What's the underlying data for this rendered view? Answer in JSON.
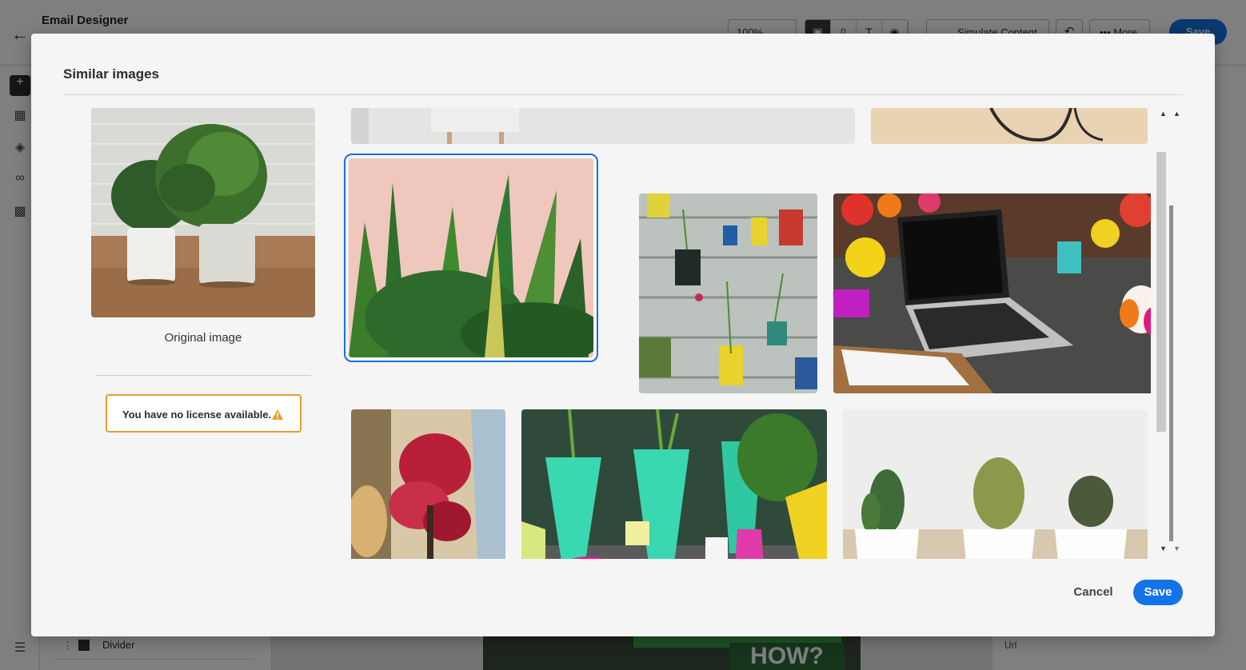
{
  "app": {
    "title": "Email Designer",
    "zoom": "100%",
    "simulate_label": "Simulate Content",
    "more_label": "More",
    "save_label": "Save",
    "panel_item_divider": "Divider",
    "right_panel_url_label": "Url",
    "canvas_text": "HOW?"
  },
  "modal": {
    "title": "Similar images",
    "original_caption": "Original image",
    "license_warning": "You have no license available.",
    "cancel_label": "Cancel",
    "save_label": "Save"
  },
  "gallery": {
    "selected_index": 0,
    "images": [
      {
        "name": "snake-plant-pink-wall"
      },
      {
        "name": "hanging-tin-can-planters"
      },
      {
        "name": "laptop-with-flowers"
      },
      {
        "name": "red-bonsai-tree"
      },
      {
        "name": "green-vases-watering-can"
      },
      {
        "name": "three-cacti-white-pots"
      }
    ]
  },
  "colors": {
    "accent": "#1473e6",
    "warning": "#e49e2e"
  }
}
